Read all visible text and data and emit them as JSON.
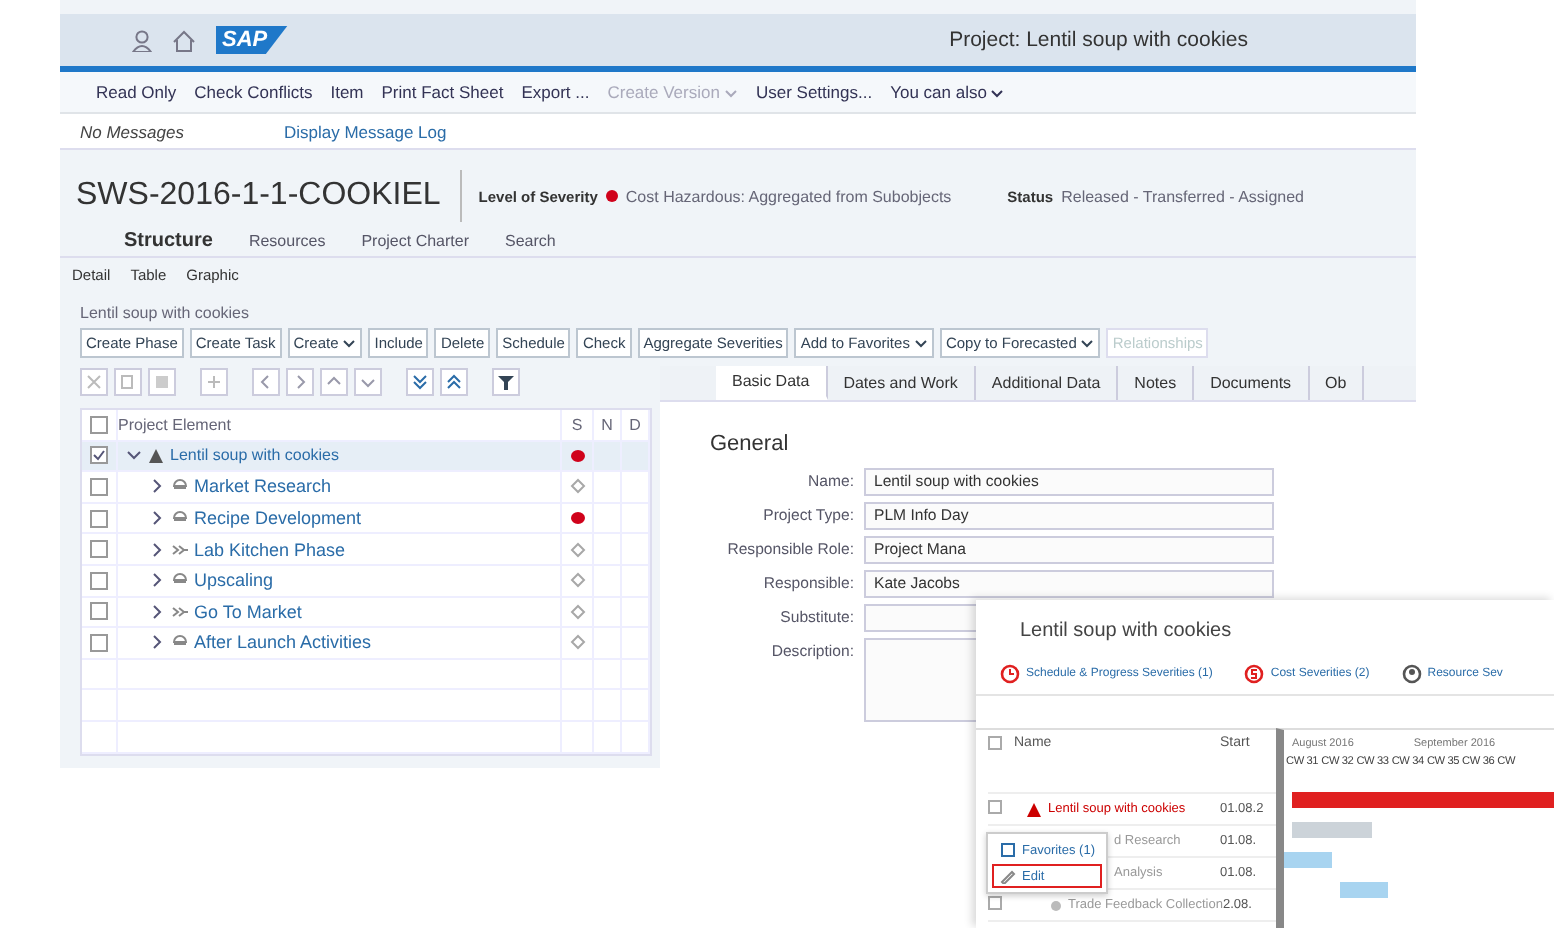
{
  "shell": {
    "logo": "SAP",
    "title": "Project: Lentil soup with cookies"
  },
  "menu": [
    {
      "label": "Read Only",
      "disabled": false,
      "dropdown": false
    },
    {
      "label": "Check Conflicts",
      "disabled": false,
      "dropdown": false
    },
    {
      "label": "Item",
      "disabled": false,
      "dropdown": false
    },
    {
      "label": "Print Fact Sheet",
      "disabled": false,
      "dropdown": false
    },
    {
      "label": "Export ...",
      "disabled": false,
      "dropdown": false
    },
    {
      "label": "Create Version",
      "disabled": true,
      "dropdown": true
    },
    {
      "label": "User Settings...",
      "disabled": false,
      "dropdown": false
    },
    {
      "label": "You can also",
      "disabled": false,
      "dropdown": true
    }
  ],
  "messages": {
    "status": "No Messages",
    "link": "Display Message Log"
  },
  "header": {
    "object_id": "SWS-2016-1-1-COOKIEL",
    "severity_label": "Level of Severity",
    "severity": "Cost Hazardous: Aggregated from Subobjects",
    "status_label": "Status",
    "status": "Released - Transferred - Assigned"
  },
  "views": [
    {
      "label": "Structure",
      "selected": true
    },
    {
      "label": "Resources",
      "selected": false
    },
    {
      "label": "Project Charter",
      "selected": false
    },
    {
      "label": "Search",
      "selected": false
    }
  ],
  "subviews": [
    "Detail",
    "Table",
    "Graphic"
  ],
  "breadcrumb": "Lentil soup with cookies",
  "actions": [
    {
      "label": "Create Phase",
      "dropdown": false,
      "disabled": false
    },
    {
      "label": "Create Task",
      "dropdown": false,
      "disabled": false
    },
    {
      "label": "Create",
      "dropdown": true,
      "disabled": false
    },
    {
      "label": "Include",
      "dropdown": false,
      "disabled": false
    },
    {
      "label": "Delete",
      "dropdown": false,
      "disabled": false
    },
    {
      "label": "Schedule",
      "dropdown": false,
      "disabled": false
    },
    {
      "label": "Check",
      "dropdown": false,
      "disabled": false
    },
    {
      "label": "Aggregate Severities",
      "dropdown": false,
      "disabled": false
    },
    {
      "label": "Add to Favorites",
      "dropdown": true,
      "disabled": false
    },
    {
      "label": "Copy to Forecasted",
      "dropdown": true,
      "disabled": false
    },
    {
      "label": "Relationships",
      "dropdown": false,
      "disabled": true
    }
  ],
  "tree": {
    "all_checked": false,
    "columns": [
      "Project Element",
      "S",
      "N",
      "D"
    ],
    "rows": [
      {
        "label": "Lentil soup with cookies",
        "kind": "project",
        "checked": true,
        "expanded": true,
        "color": "#d0021b",
        "children": [
          {
            "label": "Market Research",
            "kind": "phase",
            "checked": false,
            "expanded": false,
            "color": "#a8a8a8"
          },
          {
            "label": "Recipe Development",
            "kind": "phase",
            "checked": false,
            "expanded": false,
            "color": "#d0021b"
          },
          {
            "label": "Lab Kitchen Phase",
            "kind": "gate",
            "checked": false,
            "expanded": false,
            "color": "#a8a8a8"
          },
          {
            "label": "Upscaling",
            "kind": "phase",
            "checked": false,
            "expanded": false,
            "color": "#a8a8a8"
          },
          {
            "label": "Go To Market",
            "kind": "gate",
            "checked": false,
            "expanded": false,
            "color": "#a8a8a8"
          },
          {
            "label": "After Launch Activities",
            "kind": "phase",
            "checked": false,
            "expanded": false,
            "color": "#a8a8a8"
          }
        ]
      }
    ]
  },
  "detail_tabs": [
    {
      "label": "Basic Data",
      "selected": true
    },
    {
      "label": "Dates and Work",
      "selected": false
    },
    {
      "label": "Additional Data",
      "selected": false
    },
    {
      "label": "Notes",
      "selected": false
    },
    {
      "label": "Documents",
      "selected": false
    },
    {
      "label": "Ob",
      "selected": false
    }
  ],
  "form": {
    "section": "General",
    "fields": [
      {
        "label": "Name:",
        "value": "Lentil soup with cookies",
        "kind": "input"
      },
      {
        "label": "Project Type:",
        "value": "PLM Info Day",
        "kind": "input"
      },
      {
        "label": "Responsible Role:",
        "value": "Project Mana",
        "kind": "input"
      },
      {
        "label": "Responsible:",
        "value": "Kate Jacobs",
        "kind": "input"
      },
      {
        "label": "Substitute:",
        "kind": "input"
      },
      {
        "label": "Description:",
        "kind": "textarea"
      }
    ]
  },
  "overlay": {
    "title": "Lentil soup with cookies",
    "links": [
      {
        "label": "Schedule & Progress Severities (1)",
        "kind": "schedule"
      },
      {
        "label": "Cost Severities (2)",
        "kind": "cost"
      },
      {
        "label": "Resource Sev",
        "kind": "resource"
      }
    ],
    "all_checked": false,
    "columns": [
      "Name",
      "Start"
    ],
    "months": [
      "August 2016",
      "September 2016"
    ],
    "weeks": [
      "CW 31",
      "CW 32",
      "CW 33",
      "CW 34",
      "CW 35",
      "CW 36",
      "CW"
    ],
    "rows": [
      {
        "name": "Lentil soup with cookies",
        "start": "01.08.2",
        "kind": "summary",
        "checked": false
      },
      {
        "name": "d Research",
        "start": "01.08.",
        "kind": "phase"
      },
      {
        "name": "Analysis",
        "start": "01.08.",
        "kind": "task"
      },
      {
        "name": "Trade Feedback Collection",
        "start": "2.08.",
        "kind": "task",
        "checked": false
      }
    ],
    "popup": [
      {
        "label": "Favorites (1)",
        "kind": "favorites",
        "highlighted": false
      },
      {
        "label": "Edit",
        "kind": "edit",
        "highlighted": true
      }
    ]
  }
}
